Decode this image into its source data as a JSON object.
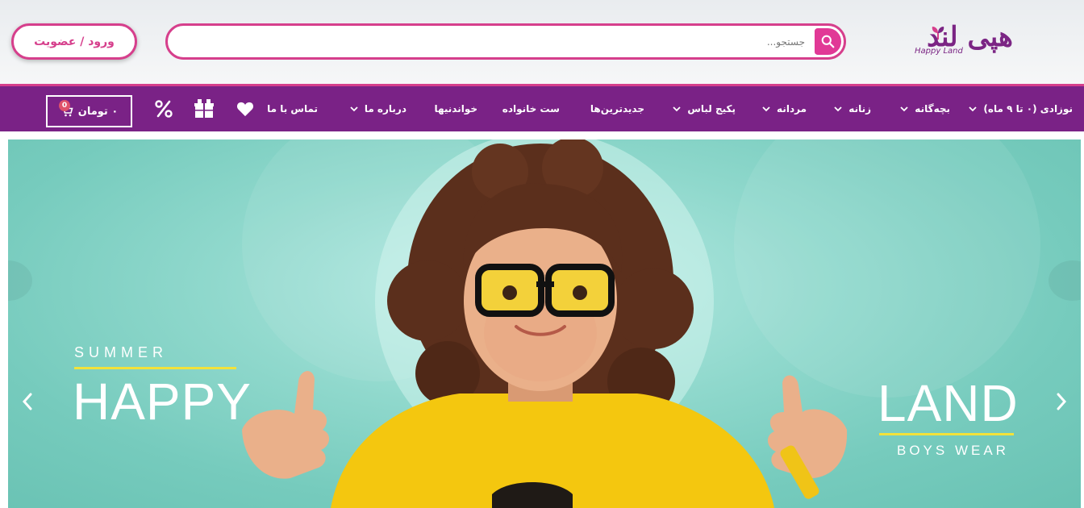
{
  "header": {
    "login_label": "ورود / عضویت",
    "search_placeholder": "جستجو...",
    "logo_fa": "هپی لند",
    "logo_en": "Happy Land"
  },
  "nav": {
    "items": [
      {
        "label": "نوزادی (۰ تا ۹ ماه)",
        "has_dropdown": true
      },
      {
        "label": "بچه‌گانه",
        "has_dropdown": true
      },
      {
        "label": "زنانه",
        "has_dropdown": true
      },
      {
        "label": "مردانه",
        "has_dropdown": true
      },
      {
        "label": "پکیج لباس",
        "has_dropdown": true
      },
      {
        "label": "جدیدترین‌ها",
        "has_dropdown": false
      },
      {
        "label": "ست خانواده",
        "has_dropdown": false
      },
      {
        "label": "خواندنیها",
        "has_dropdown": false
      },
      {
        "label": "درباره ما",
        "has_dropdown": true
      },
      {
        "label": "تماس با ما",
        "has_dropdown": false
      }
    ],
    "icons": [
      "heart-icon",
      "gift-icon",
      "percent-icon"
    ],
    "cart_label": "۰ تومان",
    "cart_count": "0"
  },
  "hero": {
    "summer": "SUMMER",
    "happy": "HAPPY",
    "land": "LAND",
    "boys_wear": "BOYS WEAR"
  },
  "colors": {
    "accent_pink": "#d63f8c",
    "nav_purple": "#7a2286",
    "hero_teal": "#8fd8cc",
    "shirt_yellow": "#f4c70f"
  }
}
